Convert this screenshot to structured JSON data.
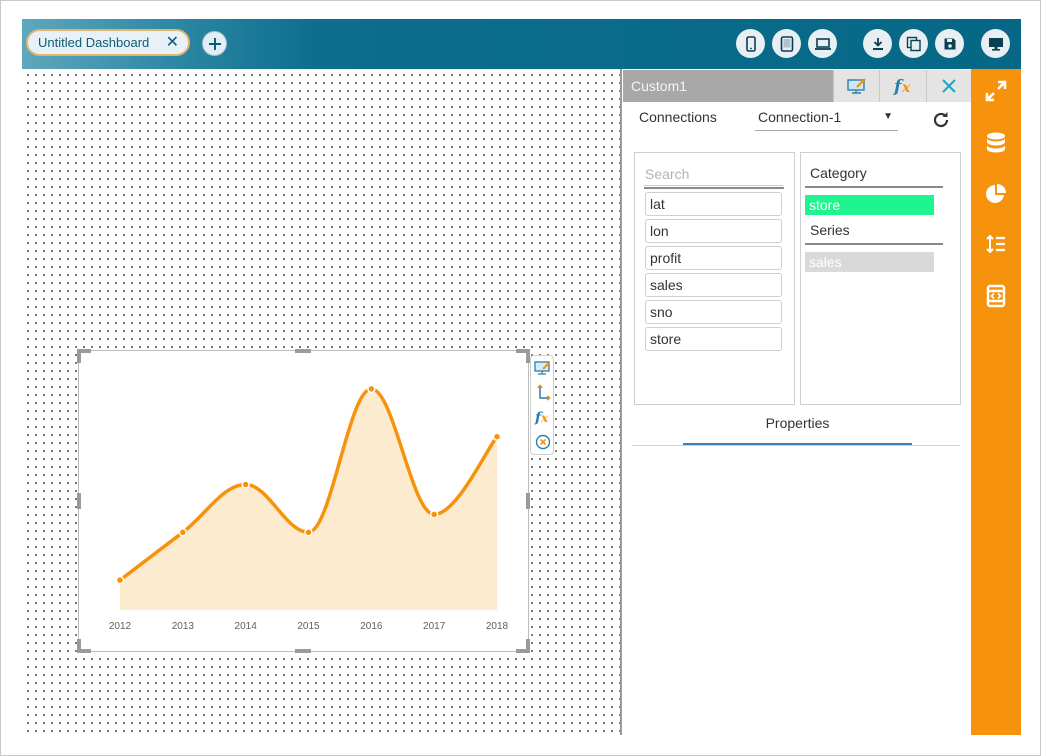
{
  "tabs": [
    {
      "label": "Untitled Dashboard",
      "close_icon": "close-icon"
    }
  ],
  "add_tab_icon": "plus-icon",
  "toolbar_buttons": [
    "mobile-icon",
    "tablet-icon",
    "laptop-icon",
    "download-icon",
    "copy-icon",
    "save-icon",
    "monitor-icon"
  ],
  "panel": {
    "title": "Custom1",
    "head_icons": [
      "edit-icon",
      "fx-icon",
      "close-icon"
    ],
    "connections_label": "Connections",
    "connection_selected": "Connection-1",
    "refresh_icon": "refresh-icon",
    "search_placeholder": "Search",
    "fields": [
      "lat",
      "lon",
      "profit",
      "sales",
      "sno",
      "store"
    ],
    "category_label": "Category",
    "category_value": "store",
    "series_label": "Series",
    "series_value": "sales",
    "properties_label": "Properties"
  },
  "rail_icons": [
    "expand-icon",
    "database-icon",
    "pie-chart-icon",
    "line-height-icon",
    "code-icon"
  ],
  "chart_tools": [
    "edit-icon",
    "axis-icon",
    "fx-icon",
    "remove-icon"
  ],
  "colors": {
    "topbar": "#066886",
    "rail": "#f7920d",
    "line": "#f7920d",
    "area": "#fdebd0",
    "category_chip": "#1ef58f",
    "series_chip": "#d9d9d9"
  },
  "chart_data": {
    "type": "area",
    "x": [
      "2012",
      "2013",
      "2014",
      "2015",
      "2016",
      "2017",
      "2018"
    ],
    "series": [
      {
        "values": [
          5,
          13,
          21,
          13,
          37,
          16,
          29
        ]
      }
    ],
    "ylim": [
      0,
      40
    ],
    "title": "",
    "xlabel": "",
    "ylabel": "",
    "grid": false,
    "smooth": true
  }
}
